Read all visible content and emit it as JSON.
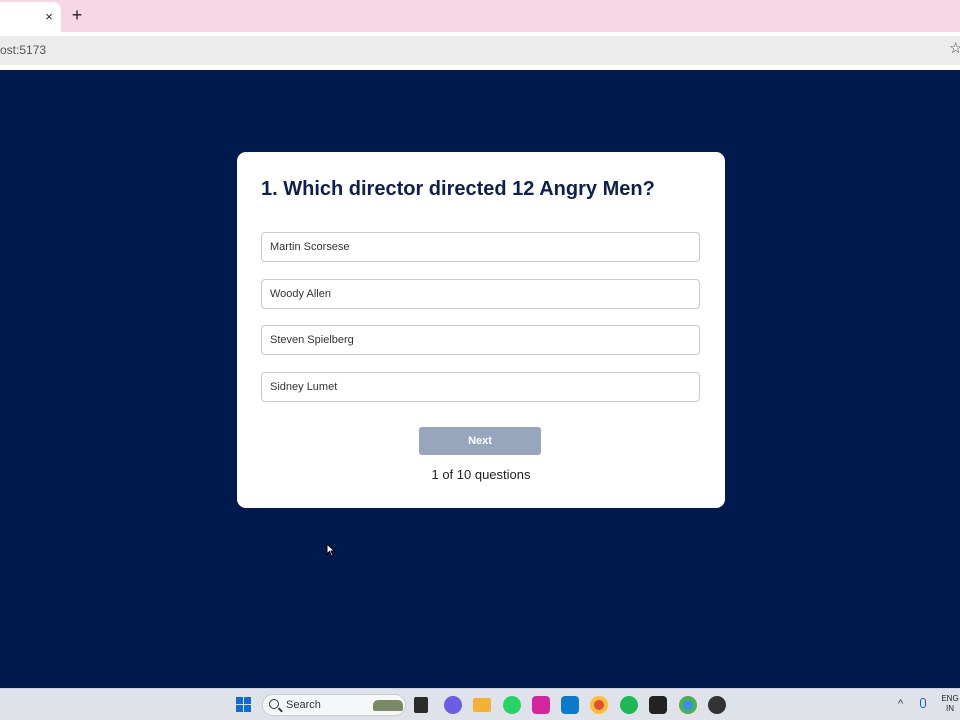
{
  "browser": {
    "tab_close": "×",
    "new_tab": "+",
    "url": "ost:5173",
    "bookmark_icon": "star-icon"
  },
  "quiz": {
    "question": "1. Which director directed 12 Angry Men?",
    "options": [
      "Martin Scorsese",
      "Woody Allen",
      "Steven Spielberg",
      "Sidney Lumet"
    ],
    "next_label": "Next",
    "progress": "1 of 10 questions"
  },
  "colors": {
    "page_background": "#001a4e",
    "card": "#ffffff",
    "question_text": "#0c2150",
    "next_button_disabled": "#97a6bd",
    "tabbar": "#f7d6e6"
  },
  "taskbar": {
    "search_label": "Search",
    "apps": [
      "windows-start-icon",
      "file-explorer-icon",
      "chat-icon",
      "folder-icon",
      "whatsapp-icon",
      "instagram-icon",
      "vscode-icon",
      "chrome-icon",
      "spotify-icon",
      "app-icon",
      "chrome-active-icon",
      "github-desktop-icon"
    ],
    "tray_chevron": "^",
    "lang_top": "ENG",
    "lang_bottom": "IN"
  }
}
